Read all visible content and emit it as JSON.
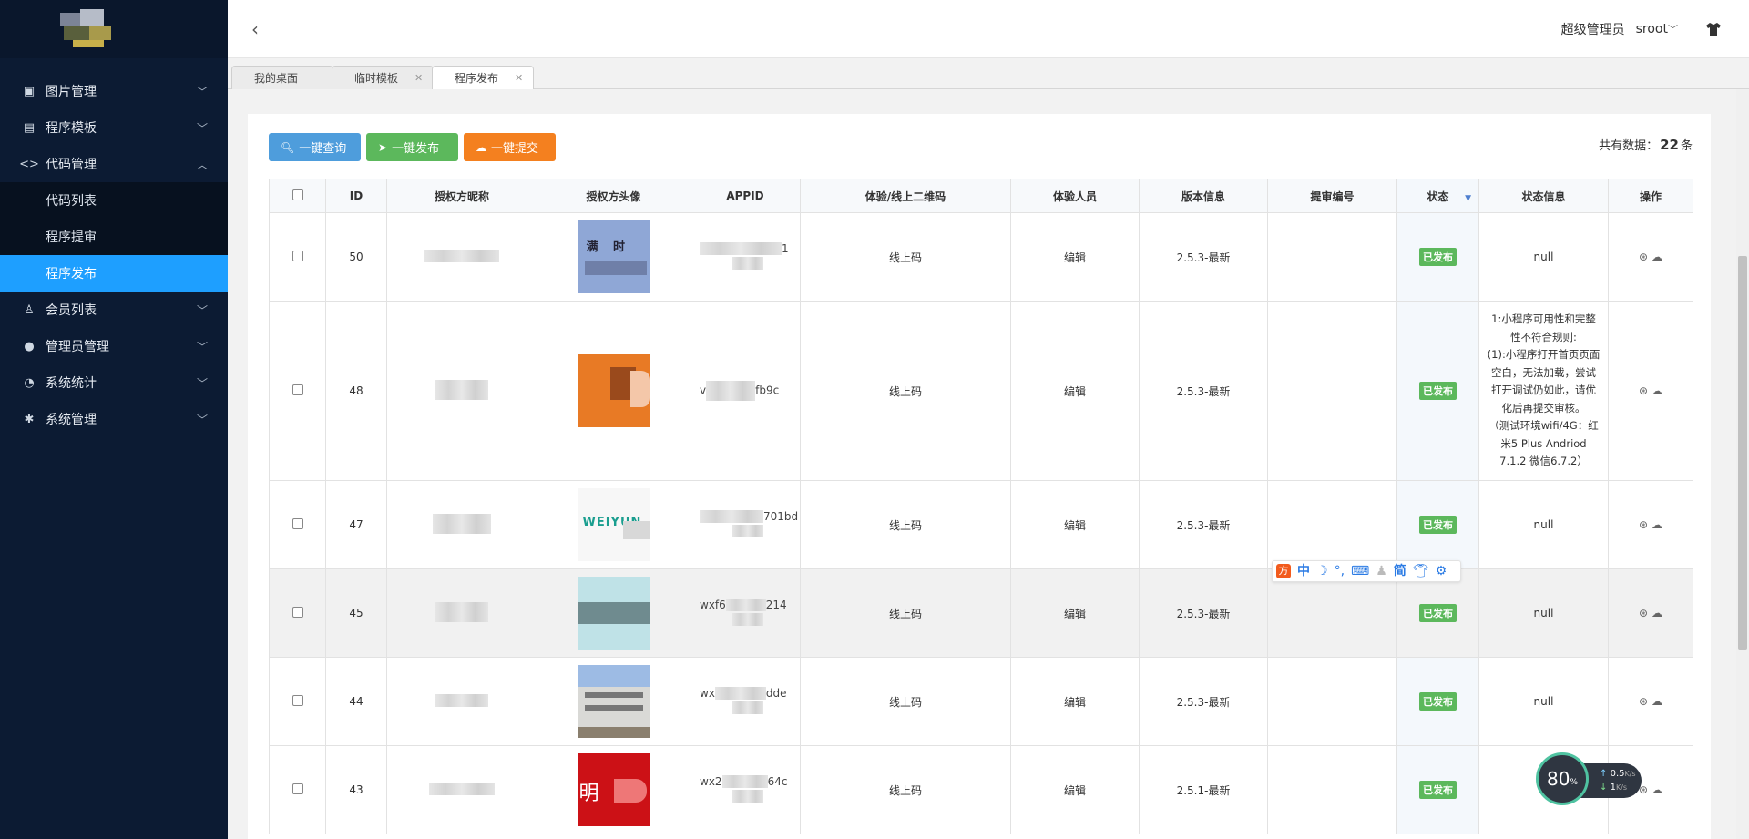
{
  "sidebar": {
    "items": [
      {
        "label": "图片管理",
        "icon": "image-icon",
        "expanded": false
      },
      {
        "label": "程序模板",
        "icon": "template-icon",
        "expanded": false
      },
      {
        "label": "代码管理",
        "icon": "code-icon",
        "expanded": true
      },
      {
        "label": "会员列表",
        "icon": "user-icon",
        "expanded": false
      },
      {
        "label": "管理员管理",
        "icon": "admin-icon",
        "expanded": false
      },
      {
        "label": "系统统计",
        "icon": "chart-icon",
        "expanded": false
      },
      {
        "label": "系统管理",
        "icon": "gear-icon",
        "expanded": false
      }
    ],
    "sub_items": [
      {
        "label": "代码列表",
        "active": false
      },
      {
        "label": "程序提审",
        "active": false
      },
      {
        "label": "程序发布",
        "active": true
      }
    ]
  },
  "header": {
    "role": "超级管理员",
    "username": "sroot"
  },
  "tabs": [
    {
      "label": "我的桌面",
      "closable": false
    },
    {
      "label": "临时模板",
      "closable": true
    },
    {
      "label": "程序发布",
      "closable": true,
      "active": true
    }
  ],
  "toolbar": {
    "query_label": "一键查询",
    "publish_label": "一键发布",
    "submit_label": "一键提交",
    "total_prefix": "共有数据：",
    "total_count": "22",
    "total_suffix": "条"
  },
  "table": {
    "columns": [
      "ID",
      "授权方昵称",
      "授权方头像",
      "APPID",
      "体验/线上二维码",
      "体验人员",
      "版本信息",
      "提审编号",
      "状态",
      "状态信息",
      "操作"
    ],
    "rows": [
      {
        "id": "50",
        "appid_a": "",
        "appid_b": "1",
        "qr": "线上码",
        "tester": "编辑",
        "version": "2.5.3-最新",
        "audit_no": "",
        "status": "已发布",
        "status_info": "null"
      },
      {
        "id": "48",
        "appid_a": "v",
        "appid_b": "fb9c",
        "qr": "线上码",
        "tester": "编辑",
        "version": "2.5.3-最新",
        "audit_no": "",
        "status": "已发布",
        "status_info": "1:小程序可用性和完整性不符合规则:\n(1):小程序打开首页页面空白，无法加载，尝试打开调试仍如此，请优化后再提交审核。\n（测试环境wifi/4G：红米5 Plus Andriod 7.1.2 微信6.7.2）"
      },
      {
        "id": "47",
        "appid_a": "",
        "appid_b": "701bd",
        "qr": "线上码",
        "tester": "编辑",
        "version": "2.5.3-最新",
        "audit_no": "",
        "status": "已发布",
        "status_info": "null"
      },
      {
        "id": "45",
        "appid_a": "wxf6",
        "appid_b": "214",
        "qr": "线上码",
        "tester": "编辑",
        "version": "2.5.3-最新",
        "audit_no": "",
        "status": "已发布",
        "status_info": "null"
      },
      {
        "id": "44",
        "appid_a": "wx",
        "appid_b": "dde",
        "qr": "线上码",
        "tester": "编辑",
        "version": "2.5.3-最新",
        "audit_no": "",
        "status": "已发布",
        "status_info": "null"
      },
      {
        "id": "43",
        "appid_a": "wx2",
        "appid_b": "64c",
        "qr": "线上码",
        "tester": "编辑",
        "version": "2.5.1-最新",
        "audit_no": "",
        "status": "已发布",
        "status_info": ""
      }
    ],
    "avatar_text": {
      "row50": "满 时",
      "row47": "WEIYUN",
      "row43": "明"
    }
  },
  "ime": {
    "items": [
      "中",
      "简"
    ]
  },
  "net": {
    "percent": "80",
    "percent_unit": "%",
    "up": "0.5",
    "down": "1",
    "unit": "K/s"
  },
  "colors": {
    "sidebar_bg": "#0c1b33",
    "active_blue": "#1e9fff",
    "btn_blue": "#4e9ddc",
    "btn_green": "#5cb85c",
    "btn_orange": "#f4801f",
    "badge_green": "#5cb85c"
  }
}
